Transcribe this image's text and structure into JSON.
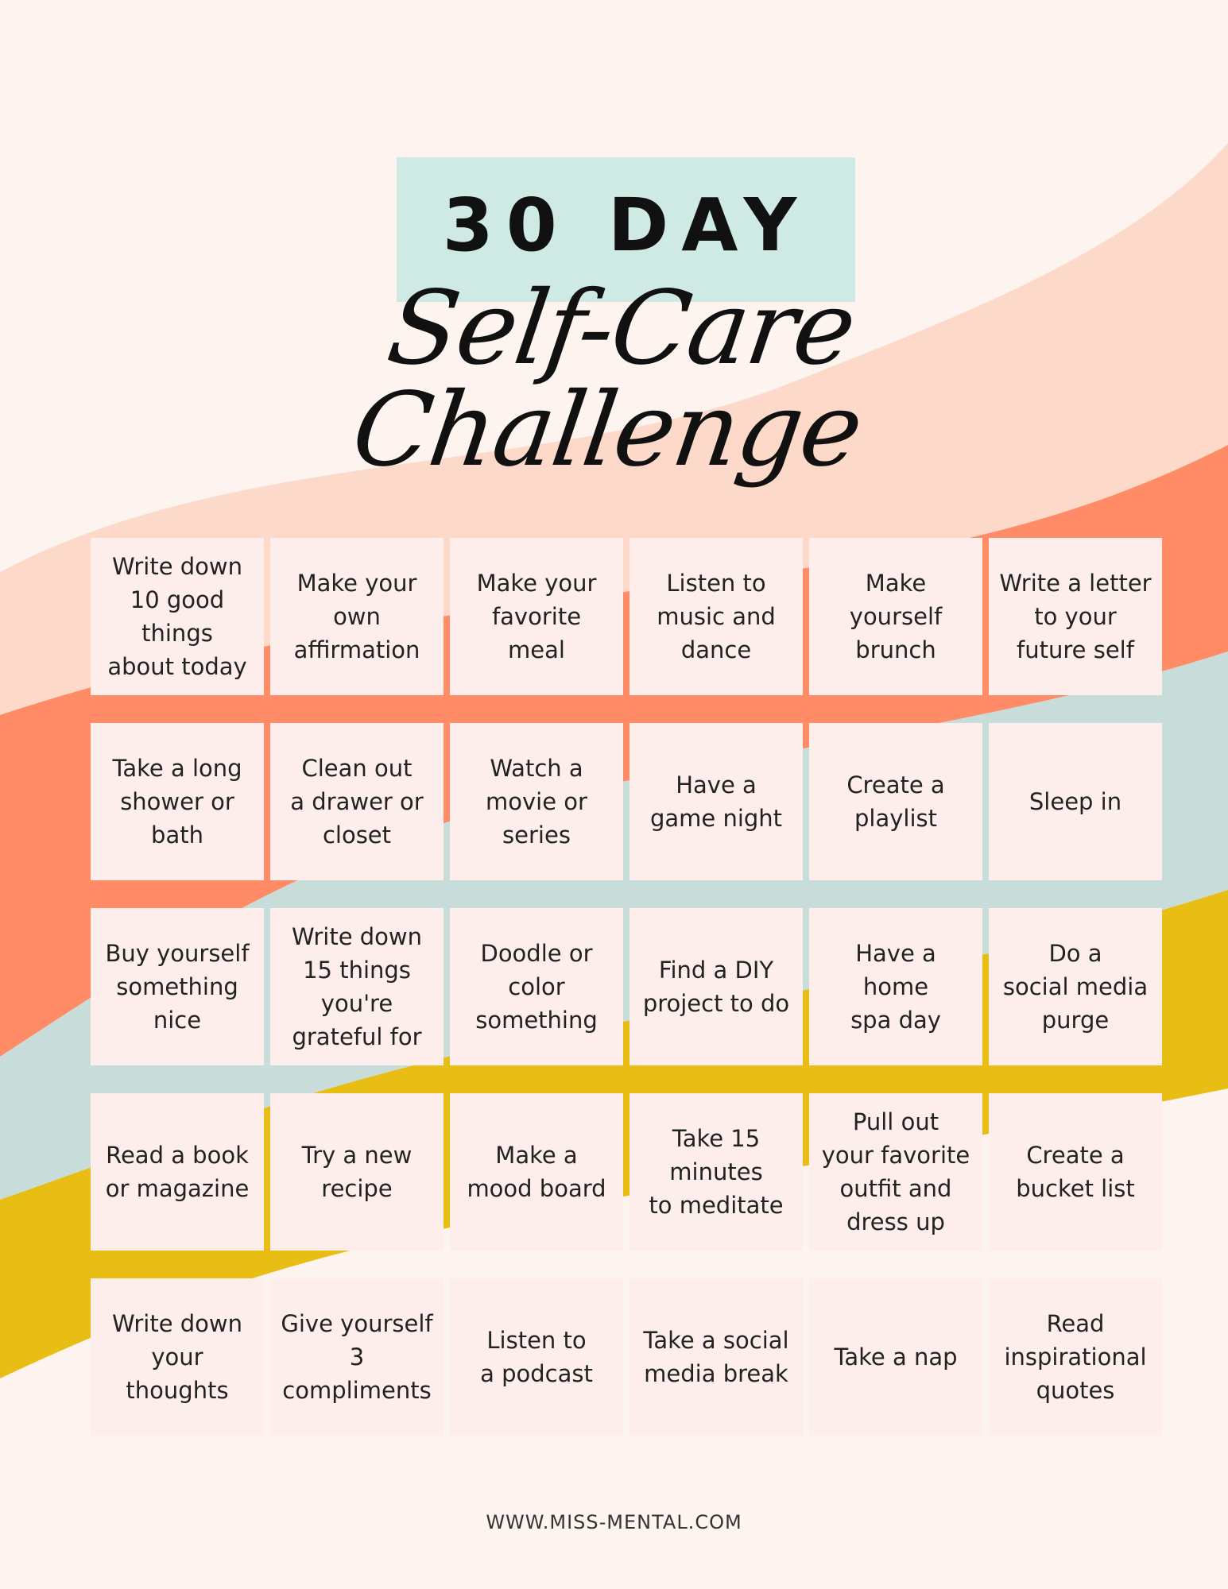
{
  "title": {
    "line1": "30 DAY",
    "line2": "Self-Care Challenge"
  },
  "colors": {
    "background": "#fdf3ef",
    "title_box": "#cfeae4",
    "peach": "#fcd9c8",
    "coral": "#ff8c66",
    "sage": "#c8ddd9",
    "mustard": "#e8bd14",
    "cell": "#fdeeeb"
  },
  "challenges": [
    "Write down\n10 good\nthings\nabout today",
    "Make your\nown\naffirmation",
    "Make your\nfavorite\nmeal",
    "Listen to\nmusic and\ndance",
    "Make\nyourself\nbrunch",
    "Write a letter\nto your\nfuture self",
    "Take a long\nshower or\nbath",
    "Clean out\na drawer or\ncloset",
    "Watch a\nmovie or\nseries",
    "Have a\ngame night",
    "Create a\nplaylist",
    "Sleep in",
    "Buy yourself\nsomething\nnice",
    "Write down\n15 things\nyou're\ngrateful for",
    "Doodle or\ncolor\nsomething",
    "Find a DIY\nproject to do",
    "Have a\nhome\nspa day",
    "Do a\nsocial media\npurge",
    "Read a book\nor magazine",
    "Try a new\nrecipe",
    "Make a\nmood board",
    "Take 15\nminutes\nto meditate",
    "Pull out\nyour favorite\noutfit and\ndress up",
    "Create a\nbucket list",
    "Write down\nyour\nthoughts",
    "Give yourself\n3\ncompliments",
    "Listen to\na podcast",
    "Take a social\nmedia break",
    "Take a nap",
    "Read\ninspirational\nquotes"
  ],
  "footer": "WWW.MISS-MENTAL.COM"
}
